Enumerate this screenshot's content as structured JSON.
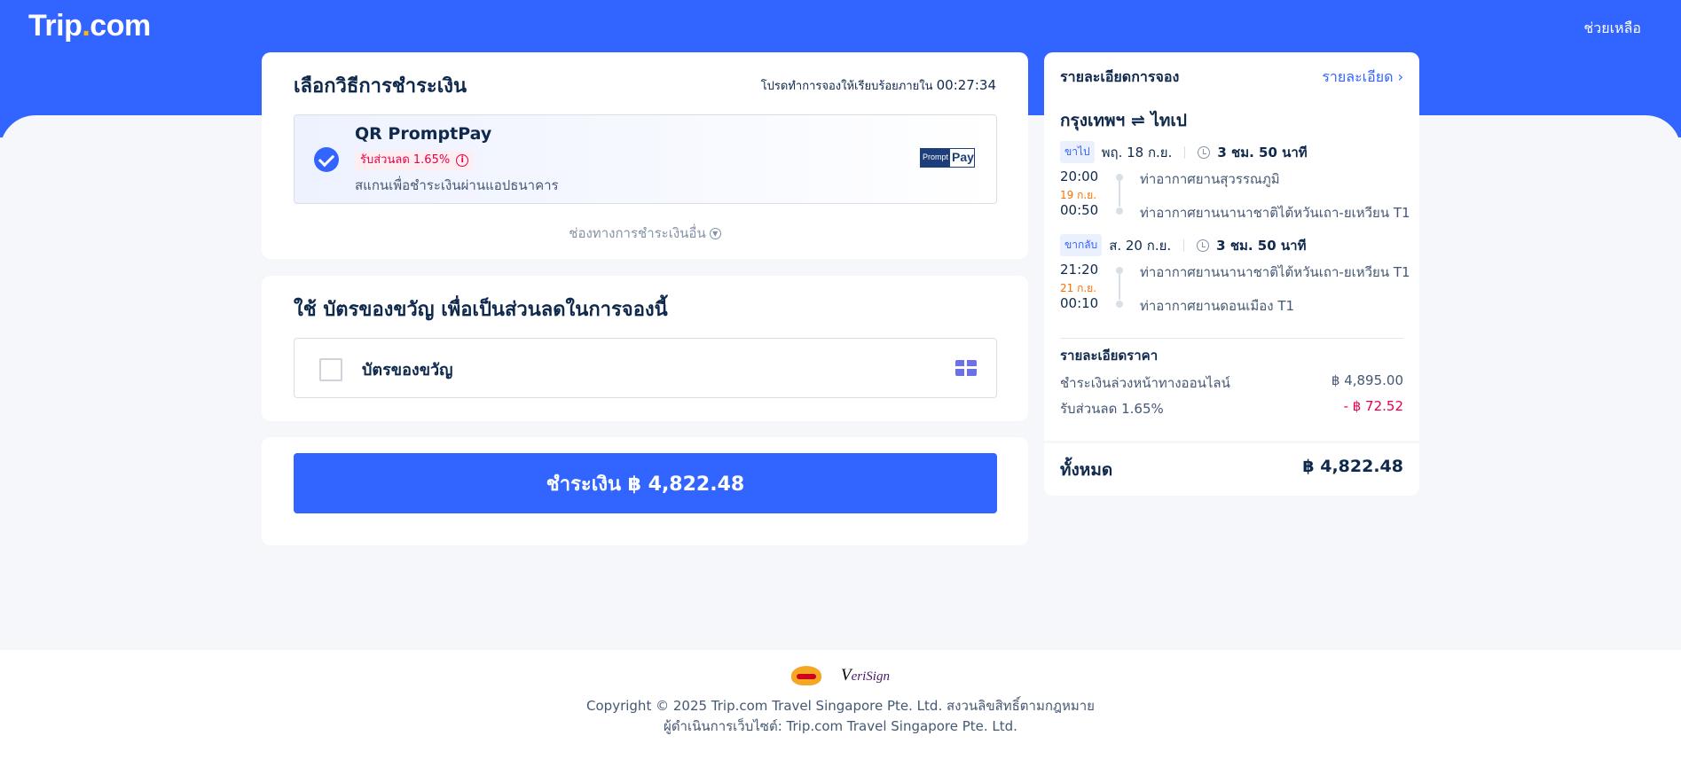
{
  "header": {
    "logo_main": "Trip",
    "logo_dot": ".",
    "logo_suffix": "com",
    "help": "ช่วยเหลือ"
  },
  "payment": {
    "title": "เลือกวิธีการชำระเงิน",
    "timer_label": "โปรดทำการจองให้เรียบร้อยภายใน",
    "timer_value": "00:27:34",
    "method": {
      "name": "QR PromptPay",
      "badge": "รับส่วนลด 1.65%",
      "desc": "สแกนเพื่อชำระเงินผ่านแอปธนาคาร",
      "logo_left": "Prompt",
      "logo_right": "Pay"
    },
    "other": "ช่องทางการชำระเงินอื่น"
  },
  "gift": {
    "title": "ใช้ บัตรของขวัญ เพื่อเป็นส่วนลดในการจองนี้",
    "label": "บัตรของขวัญ"
  },
  "submit": {
    "label": "ชำระเงิน ฿ 4,822.48"
  },
  "booking": {
    "title": "รายละเอียดการจอง",
    "detail_link": "รายละเอียด ›",
    "route": "กรุงเทพฯ ⇌ ไทเป",
    "outbound": {
      "tag": "ขาไป",
      "date": "พฤ. 18 ก.ย.",
      "duration": "3 ชม. 50 นาที",
      "dep_time": "20:00",
      "next_day": "19 ก.ย.",
      "arr_time": "00:50",
      "dep_airport": "ท่าอากาศยานสุวรรณภูมิ",
      "arr_airport": "ท่าอากาศยานนานาชาติไต้หวันเถา-ยเหวียน T1"
    },
    "inbound": {
      "tag": "ขากลับ",
      "date": "ส. 20 ก.ย.",
      "duration": "3 ชม. 50 นาที",
      "dep_time": "21:20",
      "next_day": "21 ก.ย.",
      "arr_time": "00:10",
      "dep_airport": "ท่าอากาศยานนานาชาติไต้หวันเถา-ยเหวียน T1",
      "arr_airport": "ท่าอากาศยานดอนเมือง T1"
    },
    "price": {
      "title": "รายละเอียดราคา",
      "rows": [
        {
          "label": "ชำระเงินล่วงหน้าทางออนไลน์",
          "value": "฿ 4,895.00"
        },
        {
          "label": "รับส่วนลด 1.65%",
          "value": "- ฿ 72.52"
        }
      ],
      "total_label": "ทั้งหมด",
      "total_value": "฿ 4,822.48"
    }
  },
  "footer": {
    "verisign_v": "V",
    "verisign_rest": "eriSign",
    "line1": "Copyright © 2025 Trip.com Travel Singapore Pte. Ltd. สงวนลิขสิทธิ์ตามกฎหมาย",
    "line2": "ผู้ดำเนินการเว็บไซต์: Trip.com Travel Singapore Pte. Ltd."
  }
}
